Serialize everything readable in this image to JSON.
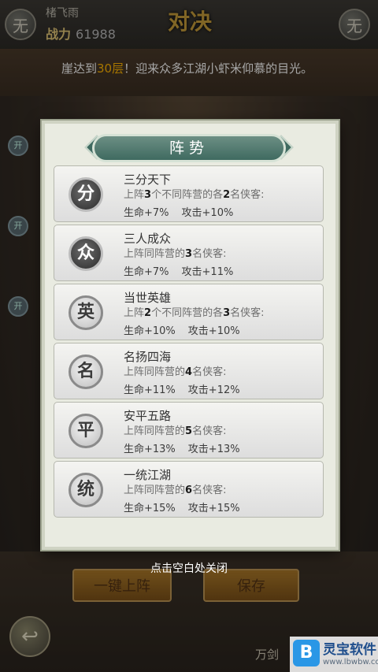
{
  "header": {
    "left_button": "无",
    "right_button": "无",
    "player_name": "楮飞雨",
    "power_label": "战力",
    "power_value": "61988",
    "vs_logo": "对决"
  },
  "banner": {
    "prefix": "崖达到",
    "floor": "30层",
    "suffix": "！迎来众多江湖小虾米仰慕的目光。"
  },
  "side_chips": [
    "开",
    "开",
    "开"
  ],
  "modal": {
    "title": "阵势",
    "items": [
      {
        "badge": "分",
        "style": "dark",
        "name": "三分天下",
        "desc_pre": "上阵",
        "desc_n1": "3",
        "desc_mid": "个不同阵营的各",
        "desc_n2": "2",
        "desc_post": "名侠客:",
        "hp": "生命+7%",
        "atk": "攻击+10%"
      },
      {
        "badge": "众",
        "style": "dark",
        "name": "三人成众",
        "desc_pre": "上阵同阵营的",
        "desc_n1": "3",
        "desc_mid": "名侠客:",
        "desc_n2": "",
        "desc_post": "",
        "hp": "生命+7%",
        "atk": "攻击+11%"
      },
      {
        "badge": "英",
        "style": "light",
        "name": "当世英雄",
        "desc_pre": "上阵",
        "desc_n1": "2",
        "desc_mid": "个不同阵营的各",
        "desc_n2": "3",
        "desc_post": "名侠客:",
        "hp": "生命+10%",
        "atk": "攻击+10%"
      },
      {
        "badge": "名",
        "style": "light",
        "name": "名扬四海",
        "desc_pre": "上阵同阵营的",
        "desc_n1": "4",
        "desc_mid": "名侠客:",
        "desc_n2": "",
        "desc_post": "",
        "hp": "生命+11%",
        "atk": "攻击+12%"
      },
      {
        "badge": "平",
        "style": "light",
        "name": "安平五路",
        "desc_pre": "上阵同阵营的",
        "desc_n1": "5",
        "desc_mid": "名侠客:",
        "desc_n2": "",
        "desc_post": "",
        "hp": "生命+13%",
        "atk": "攻击+13%"
      },
      {
        "badge": "统",
        "style": "light",
        "name": "一统江湖",
        "desc_pre": "上阵同阵营的",
        "desc_n1": "6",
        "desc_mid": "名侠客:",
        "desc_n2": "",
        "desc_post": "",
        "hp": "生命+15%",
        "atk": "攻击+15%"
      }
    ]
  },
  "close_hint": "点击空白处关闭",
  "bottom": {
    "deploy_button": "一键上阵",
    "save_button": "保存",
    "back_icon": "↩",
    "wanjian_label": "万剑"
  },
  "watermark": {
    "icon": "B",
    "name": "灵宝软件",
    "url": "www.lbwbw.com"
  }
}
